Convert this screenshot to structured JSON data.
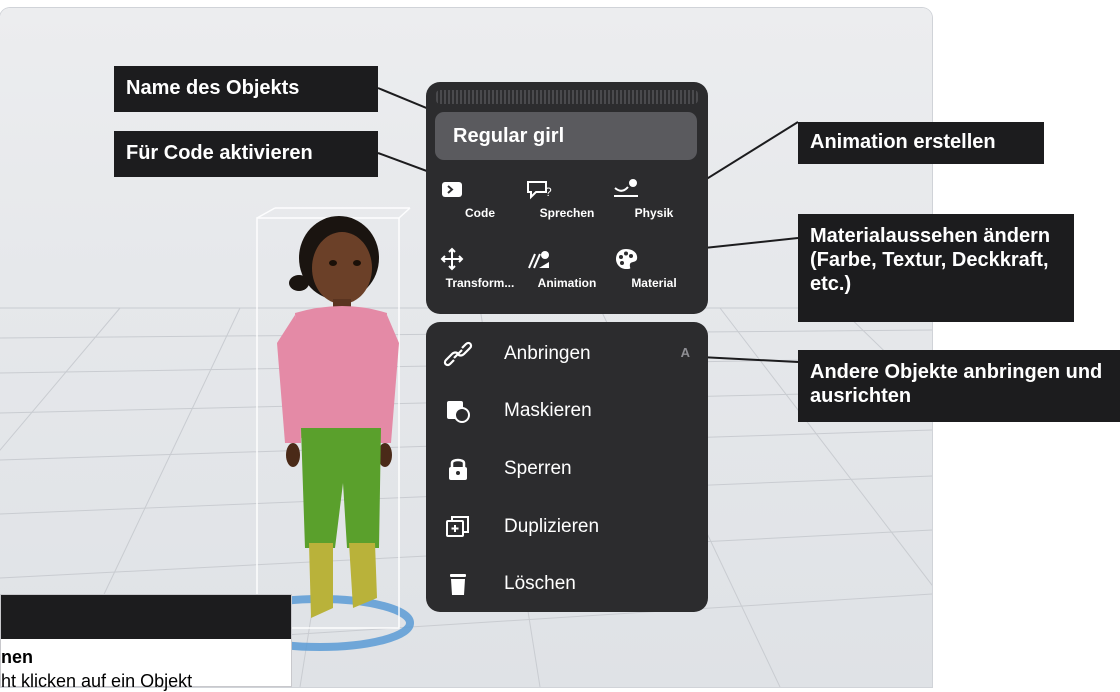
{
  "object_panel": {
    "name": "Regular girl",
    "tools": [
      {
        "label": "Code",
        "icon": "code-icon"
      },
      {
        "label": "Sprechen",
        "icon": "speech-bubble-icon"
      },
      {
        "label": "Physik",
        "icon": "physics-icon"
      },
      {
        "label": "Transform...",
        "icon": "move-arrows-icon"
      },
      {
        "label": "Animation",
        "icon": "animation-icon"
      },
      {
        "label": "Material",
        "icon": "palette-icon"
      }
    ]
  },
  "context_menu": {
    "items": [
      {
        "label": "Anbringen",
        "icon": "attach-icon",
        "shortcut": "A"
      },
      {
        "label": "Maskieren",
        "icon": "mask-icon"
      },
      {
        "label": "Sperren",
        "icon": "lock-icon"
      },
      {
        "label": "Duplizieren",
        "icon": "duplicate-icon"
      },
      {
        "label": "Löschen",
        "icon": "trash-icon"
      }
    ]
  },
  "callouts": {
    "name": "Name des Objekts",
    "code": "Für Code aktivieren",
    "animation": "Animation erstellen",
    "material": "Materialaussehen ändern (Farbe, Textur, Deckkraft, etc.)",
    "attach": "Andere Objekte anbringen und ausrichten"
  },
  "bottom_card": {
    "title": "nen",
    "text": "ht klicken auf ein Objekt"
  }
}
